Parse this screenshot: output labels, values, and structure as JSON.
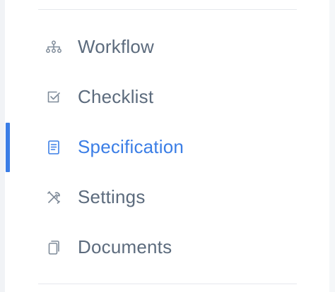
{
  "sidebar": {
    "items": [
      {
        "label": "Workflow",
        "icon": "workflow-icon",
        "active": false
      },
      {
        "label": "Checklist",
        "icon": "checklist-icon",
        "active": false
      },
      {
        "label": "Specification",
        "icon": "specification-icon",
        "active": true
      },
      {
        "label": "Settings",
        "icon": "settings-icon",
        "active": false
      },
      {
        "label": "Documents",
        "icon": "documents-icon",
        "active": false
      }
    ]
  },
  "colors": {
    "accent": "#3b7ee6",
    "text": "#5c6b7d",
    "icon": "#7f8b99",
    "divider": "#e5e8ed"
  }
}
